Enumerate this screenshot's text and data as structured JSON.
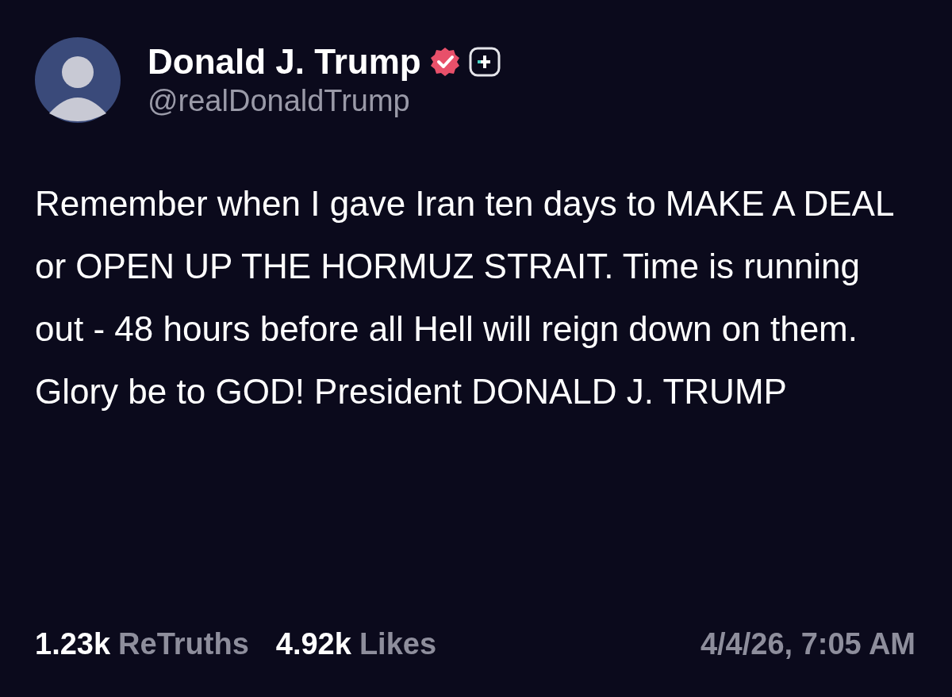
{
  "author": {
    "name": "Donald J. Trump",
    "handle": "@realDonaldTrump",
    "verified": true
  },
  "post": {
    "text": "Remember when I gave Iran ten days to MAKE A DEAL or OPEN UP THE HORMUZ STRAIT. Time is running out - 48 hours before all Hell will reign down on them. Glory be to GOD! President DONALD J. TRUMP"
  },
  "stats": [
    {
      "count": "1.23k",
      "label": "ReTruths"
    },
    {
      "count": "4.92k",
      "label": "Likes"
    }
  ],
  "timestamp": "4/4/26, 7:05 AM"
}
